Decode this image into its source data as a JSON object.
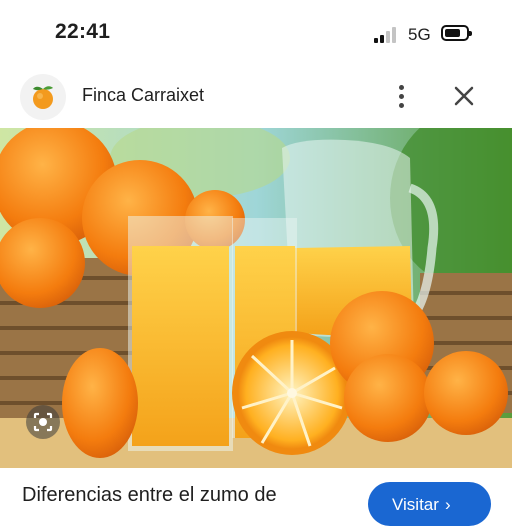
{
  "status_bar": {
    "time": "22:41",
    "network": "5G",
    "signal_bars": 4,
    "signal_bars_filled": 2
  },
  "header": {
    "site_name": "Finca Carraixet"
  },
  "result": {
    "title": "Diferencias entre el zumo de",
    "visit_label": "Visitar"
  },
  "icons": {
    "logo": "orange-fruit-icon",
    "more": "more-vertical-icon",
    "close": "close-icon",
    "lens": "lens-search-icon",
    "visit": "chevron-right-icon"
  },
  "colors": {
    "accent": "#1a67d2",
    "text": "#1f1f1f"
  }
}
